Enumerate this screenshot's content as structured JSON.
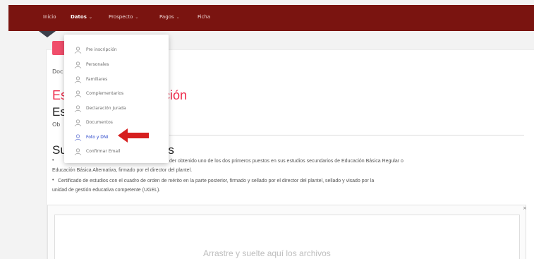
{
  "nav": {
    "items": [
      {
        "label": "Inicio",
        "active": false,
        "caret": false
      },
      {
        "label": "Datos",
        "active": true,
        "caret": true
      },
      {
        "label": "Prospecto",
        "active": false,
        "caret": true
      },
      {
        "label": "Pagos",
        "active": false,
        "caret": true
      },
      {
        "label": "Ficha",
        "active": false,
        "caret": false
      }
    ],
    "caret_glyph": "⌄"
  },
  "dropdown": {
    "items": [
      {
        "label": "Pre inscripción"
      },
      {
        "label": "Personales"
      },
      {
        "label": "Familiares"
      },
      {
        "label": "Complementarios"
      },
      {
        "label": "Declaración Jurada"
      },
      {
        "label": "Documentos"
      },
      {
        "label": "Foto y DNI",
        "current": true
      },
      {
        "label": "Confirmar Email"
      }
    ],
    "icon": "user-icon"
  },
  "page": {
    "breadcrumb": "Doc",
    "title_red_left": "Es",
    "title_red_right": "ción",
    "title_dark": "Es",
    "subtitle": "Ob",
    "section_left": "Su",
    "section_right": "atos",
    "paragraph_line1": "der obtenido uno de los dos primeros puestos en sus estudios secundarios de Educación Básica Regular o",
    "paragraph_line2": "Educación Básica Alternativa, firmado por el director del plantel.",
    "paragraph_line3": "Certificado de estudios con el cuadro de orden de mérito en la parte posterior, firmado y sellado por el director del plantel, sellado y visado por la",
    "paragraph_line4": "unidad de gestión educativa competente (UGEL).",
    "bullet": "•"
  },
  "upload": {
    "drop_text": "Arrastre y suelte aquí los archivos",
    "close_label": "×"
  },
  "colors": {
    "topbar": "#7a1410",
    "accent_red": "#ee2a4a",
    "pink_button": "#f04e6b",
    "annotation_arrow": "#d61f1f"
  }
}
